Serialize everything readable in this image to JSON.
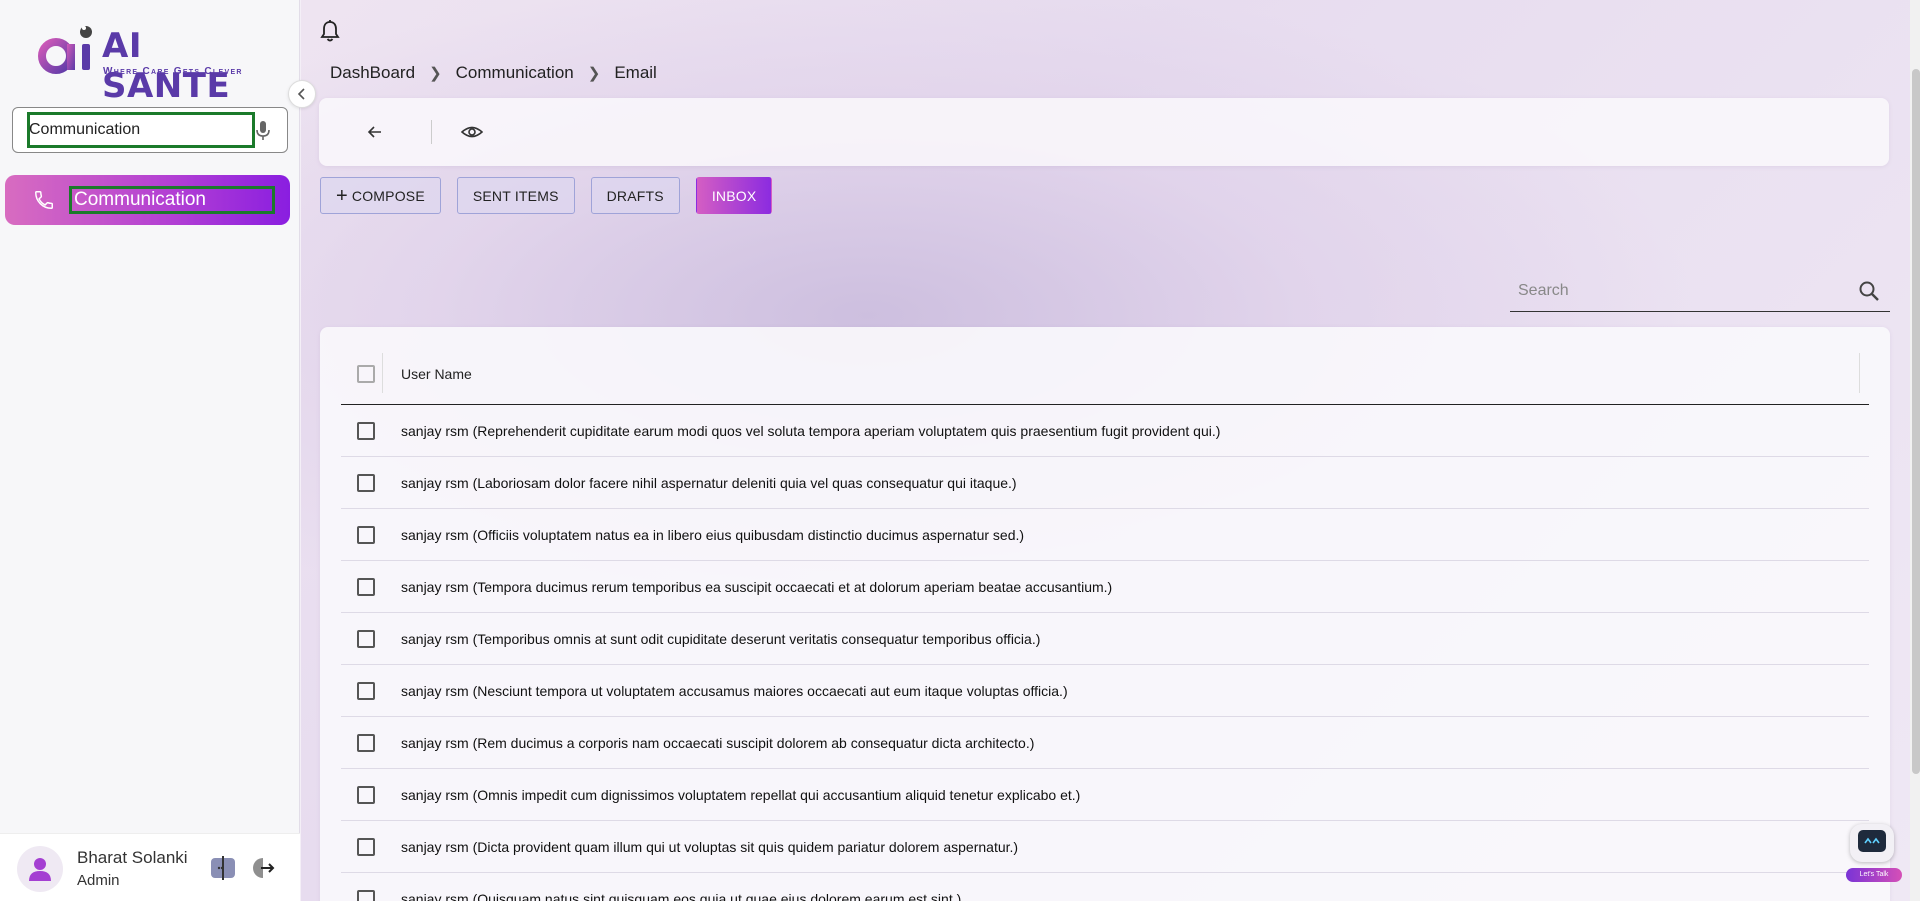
{
  "brand": {
    "title": "AI SANTE",
    "tagline": "Where Care Gets Clever",
    "primary_color": "#5a3aa8",
    "accent_gradient": [
      "#d45ec3",
      "#8c2be0"
    ]
  },
  "sidebar": {
    "search_value": "Communication",
    "search_icon": "mic-icon",
    "items": [
      {
        "label": "Communication",
        "icon": "phone-icon",
        "active": true
      }
    ],
    "user": {
      "name": "Bharat Solanki",
      "role": "Admin"
    }
  },
  "breadcrumb": [
    "DashBoard",
    "Communication",
    "Email"
  ],
  "tabs": {
    "compose": "COMPOSE",
    "sent": "SENT ITEMS",
    "drafts": "DRAFTS",
    "inbox": "INBOX",
    "active": "INBOX"
  },
  "search": {
    "placeholder": "Search"
  },
  "table": {
    "header": "User Name",
    "rows": [
      "sanjay rsm (Reprehenderit cupiditate earum modi quos vel soluta tempora aperiam voluptatem quis praesentium fugit provident qui.)",
      "sanjay rsm (Laboriosam dolor facere nihil aspernatur deleniti quia vel quas consequatur qui itaque.)",
      "sanjay rsm (Officiis voluptatem natus ea in libero eius quibusdam distinctio ducimus aspernatur sed.)",
      "sanjay rsm (Tempora ducimus rerum temporibus ea suscipit occaecati et at dolorum aperiam beatae accusantium.)",
      "sanjay rsm (Temporibus omnis at sunt odit cupiditate deserunt veritatis consequatur temporibus officia.)",
      "sanjay rsm (Nesciunt tempora ut voluptatem accusamus maiores occaecati aut eum itaque voluptas officia.)",
      "sanjay rsm (Rem ducimus a corporis nam occaecati suscipit dolorem ab consequatur dicta architecto.)",
      "sanjay rsm (Omnis impedit cum dignissimos voluptatem repellat qui accusantium aliquid tenetur explicabo et.)",
      "sanjay rsm (Dicta provident quam illum qui ut voluptas sit quis quidem pariatur dolorem aspernatur.)",
      "sanjay rsm (Quisquam natus sint quisquam eos quia ut quae eius dolorem earum est sint.)"
    ]
  },
  "chatbot": {
    "label": "Let's Talk"
  }
}
